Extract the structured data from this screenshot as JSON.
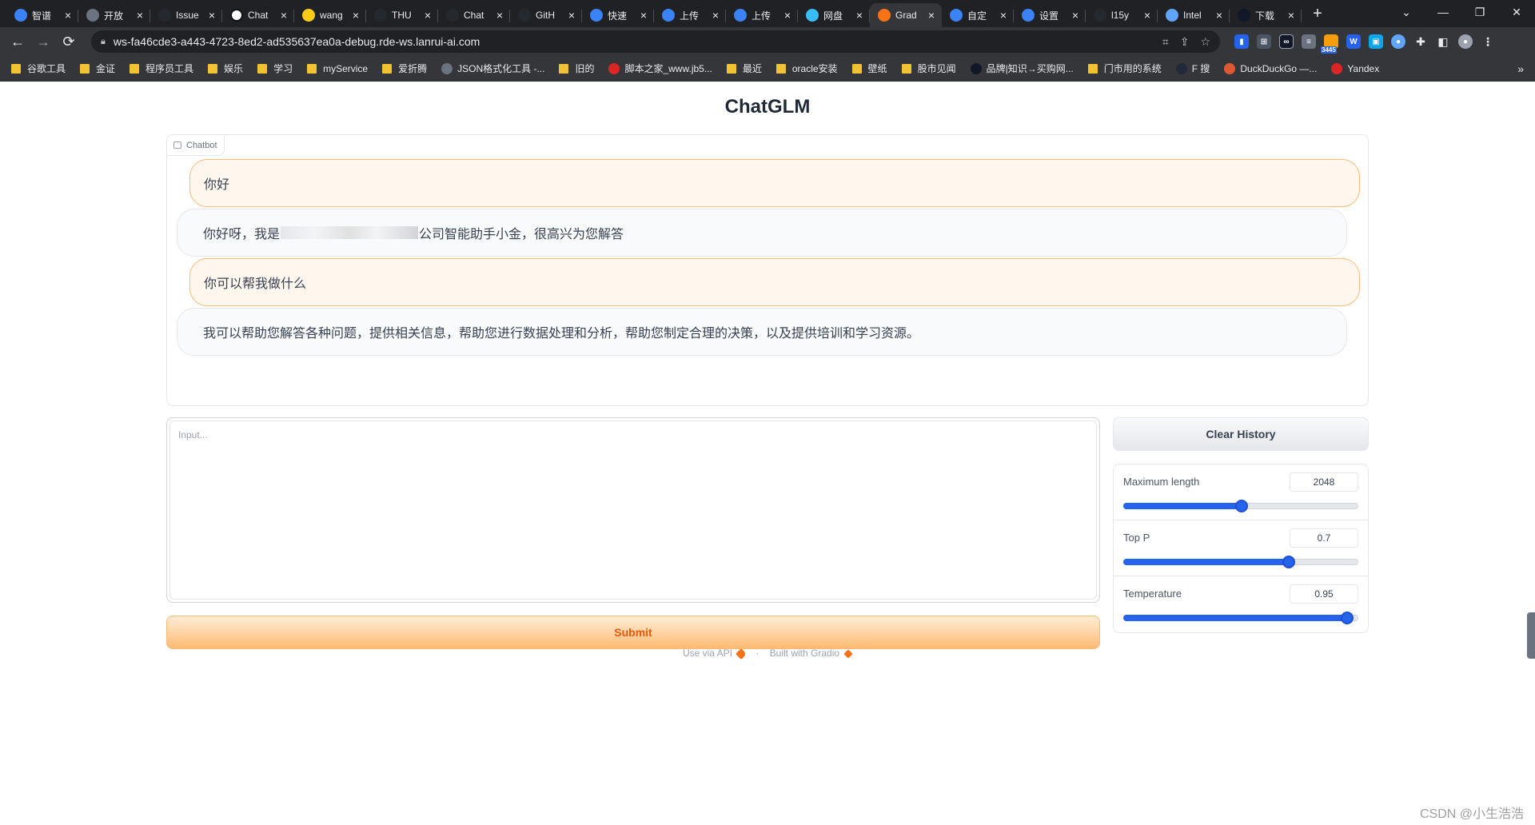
{
  "browser": {
    "tabs": [
      {
        "title": "智谱",
        "color": "#3b82f6"
      },
      {
        "title": "开放",
        "color": "#6b7280"
      },
      {
        "title": "Issue",
        "color": "#24292f"
      },
      {
        "title": "Chat",
        "color": "#ffffff"
      },
      {
        "title": "wang",
        "color": "#facc15"
      },
      {
        "title": "THU",
        "color": "#24292f"
      },
      {
        "title": "Chat",
        "color": "#24292f"
      },
      {
        "title": "GitH",
        "color": "#24292f"
      },
      {
        "title": "快速",
        "color": "#3b82f6"
      },
      {
        "title": "上传",
        "color": "#3b82f6"
      },
      {
        "title": "上传",
        "color": "#3b82f6"
      },
      {
        "title": "网盘",
        "color": "#38bdf8"
      },
      {
        "title": "Grad",
        "color": "#f97316",
        "active": true
      },
      {
        "title": "自定",
        "color": "#3b82f6"
      },
      {
        "title": "设置",
        "color": "#3b82f6"
      },
      {
        "title": "l15y",
        "color": "#24292f"
      },
      {
        "title": "Intel",
        "color": "#60a5fa"
      },
      {
        "title": "下载",
        "color": "#111827"
      }
    ],
    "url": "ws-fa46cde3-a443-4723-8ed2-ad535637ea0a-debug.rde-ws.lanrui-ai.com",
    "bookmarks": [
      {
        "label": "谷歌工具",
        "type": "folder"
      },
      {
        "label": "金证",
        "type": "folder"
      },
      {
        "label": "程序员工具",
        "type": "folder"
      },
      {
        "label": "娱乐",
        "type": "folder"
      },
      {
        "label": "学习",
        "type": "folder"
      },
      {
        "label": "myService",
        "type": "folder"
      },
      {
        "label": "爱折腾",
        "type": "folder"
      },
      {
        "label": "JSON格式化工具 -...",
        "type": "site",
        "color": "#6b7280"
      },
      {
        "label": "旧的",
        "type": "folder"
      },
      {
        "label": "脚本之家_www.jb5...",
        "type": "site",
        "color": "#dc2626"
      },
      {
        "label": "最近",
        "type": "folder"
      },
      {
        "label": "oracle安装",
        "type": "folder"
      },
      {
        "label": "壁纸",
        "type": "folder"
      },
      {
        "label": "股市见闻",
        "type": "folder"
      },
      {
        "label": "品牌|知识→买购网...",
        "type": "site",
        "color": "#111827"
      },
      {
        "label": "门市用的系统",
        "type": "folder"
      },
      {
        "label": "F 搜",
        "type": "site",
        "color": "#1f2937"
      },
      {
        "label": "DuckDuckGo —...",
        "type": "site",
        "color": "#de5833"
      },
      {
        "label": "Yandex",
        "type": "site",
        "color": "#dc2626"
      }
    ],
    "ext_badge": "3445"
  },
  "app": {
    "title": "ChatGLM",
    "chatbot_label": "Chatbot",
    "messages": [
      {
        "role": "user",
        "text": "你好"
      },
      {
        "role": "bot",
        "text_before": "你好呀，我是",
        "text_after": "公司智能助手小金，很高兴为您解答"
      },
      {
        "role": "user",
        "text": "你可以帮我做什么"
      },
      {
        "role": "bot",
        "text": "我可以帮助您解答各种问题，提供相关信息，帮助您进行数据处理和分析，帮助您制定合理的决策，以及提供培训和学习资源。"
      }
    ],
    "input": {
      "placeholder": "Input...",
      "value": ""
    },
    "submit_label": "Submit",
    "clear_label": "Clear History",
    "sliders": [
      {
        "label": "Maximum length",
        "value": "2048",
        "fraction": 0.5
      },
      {
        "label": "Top P",
        "value": "0.7",
        "fraction": 0.7
      },
      {
        "label": "Temperature",
        "value": "0.95",
        "fraction": 0.95
      }
    ],
    "footer": {
      "api": "Use via API",
      "built": "Built with Gradio"
    }
  },
  "watermark": "CSDN @小生浩浩"
}
